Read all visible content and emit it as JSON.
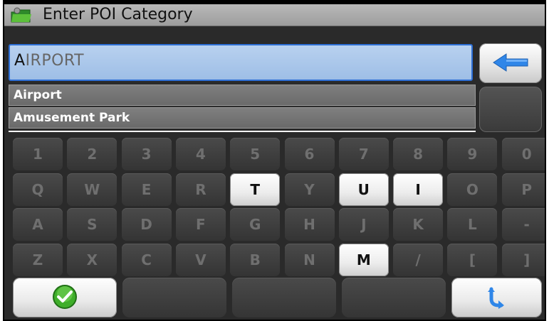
{
  "window": {
    "title": "Enter POI Category",
    "icon": "folder-poi-icon"
  },
  "search": {
    "typed": "A",
    "completion": "IRPORT",
    "back_icon": "backspace-arrow-icon"
  },
  "suggestions": [
    "Airport",
    "Amusement Park"
  ],
  "keyboard": {
    "rows": [
      [
        "1",
        "2",
        "3",
        "4",
        "5",
        "6",
        "7",
        "8",
        "9",
        "0"
      ],
      [
        "Q",
        "W",
        "E",
        "R",
        "T",
        "Y",
        "U",
        "I",
        "O",
        "P"
      ],
      [
        "A",
        "S",
        "D",
        "F",
        "G",
        "H",
        "J",
        "K",
        "L",
        "-"
      ],
      [
        "Z",
        "X",
        "C",
        "V",
        "B",
        "N",
        "M",
        "/",
        "[",
        "]"
      ]
    ],
    "enabled": [
      "T",
      "U",
      "I",
      "M"
    ]
  },
  "bottom_bar": {
    "ok_icon": "checkmark-icon",
    "return_icon": "return-arrow-icon"
  },
  "colors": {
    "input_bg": "#b0cbee",
    "input_border": "#2d6fd6",
    "arrow": "#2f86e8",
    "check": "#3fae2a"
  }
}
